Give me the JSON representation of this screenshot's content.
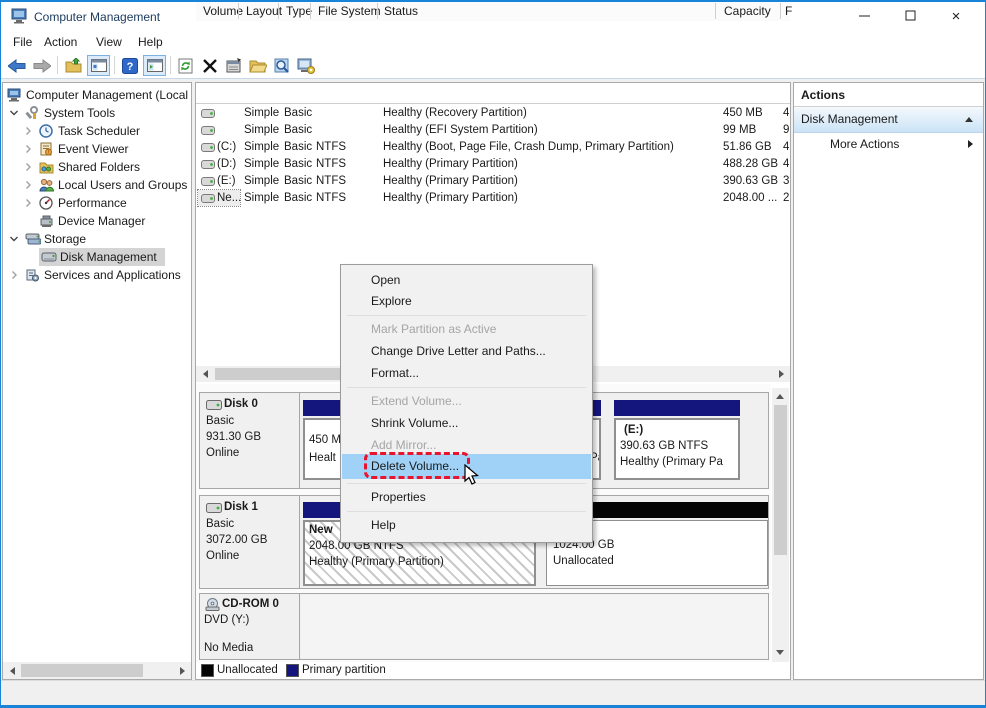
{
  "window": {
    "title": "Computer Management"
  },
  "menu_bar": {
    "items": [
      "File",
      "Action",
      "View",
      "Help"
    ]
  },
  "tree": {
    "items": [
      {
        "label": "Computer Management (Local"
      },
      {
        "label": "System Tools"
      },
      {
        "label": "Task Scheduler"
      },
      {
        "label": "Event Viewer"
      },
      {
        "label": "Shared Folders"
      },
      {
        "label": "Local Users and Groups"
      },
      {
        "label": "Performance"
      },
      {
        "label": "Device Manager"
      },
      {
        "label": "Storage"
      },
      {
        "label": "Disk Management"
      },
      {
        "label": "Services and Applications"
      }
    ]
  },
  "volume_table": {
    "headers": [
      "Volume",
      "Layout",
      "Type",
      "File System",
      "Status",
      "Capacity",
      "F"
    ],
    "rows": [
      {
        "volume": "",
        "layout": "Simple",
        "type": "Basic",
        "fs": "",
        "status": "Healthy (Recovery Partition)",
        "capacity": "450 MB",
        "free": "4"
      },
      {
        "volume": "",
        "layout": "Simple",
        "type": "Basic",
        "fs": "",
        "status": "Healthy (EFI System Partition)",
        "capacity": "99 MB",
        "free": "9"
      },
      {
        "volume": "(C:)",
        "layout": "Simple",
        "type": "Basic",
        "fs": "NTFS",
        "status": "Healthy (Boot, Page File, Crash Dump, Primary Partition)",
        "capacity": "51.86 GB",
        "free": "4"
      },
      {
        "volume": "(D:)",
        "layout": "Simple",
        "type": "Basic",
        "fs": "NTFS",
        "status": "Healthy (Primary Partition)",
        "capacity": "488.28 GB",
        "free": "4"
      },
      {
        "volume": "(E:)",
        "layout": "Simple",
        "type": "Basic",
        "fs": "NTFS",
        "status": "Healthy (Primary Partition)",
        "capacity": "390.63 GB",
        "free": "3"
      },
      {
        "volume": "Ne...",
        "layout": "Simple",
        "type": "Basic",
        "fs": "NTFS",
        "status": "Healthy (Primary Partition)",
        "capacity": "2048.00 ...",
        "free": "2"
      }
    ]
  },
  "context_menu": {
    "items": [
      {
        "label": "Open",
        "state": "enabled"
      },
      {
        "label": "Explore",
        "state": "enabled"
      },
      {
        "label": "Mark Partition as Active",
        "state": "disabled"
      },
      {
        "label": "Change Drive Letter and Paths...",
        "state": "enabled"
      },
      {
        "label": "Format...",
        "state": "enabled"
      },
      {
        "label": "Extend Volume...",
        "state": "disabled"
      },
      {
        "label": "Shrink Volume...",
        "state": "enabled"
      },
      {
        "label": "Add Mirror...",
        "state": "disabled"
      },
      {
        "label": "Delete Volume...",
        "state": "highlighted"
      },
      {
        "label": "Properties",
        "state": "enabled"
      },
      {
        "label": "Help",
        "state": "enabled"
      }
    ]
  },
  "disk_view": {
    "disk0": {
      "name": "Disk 0",
      "type": "Basic",
      "size": "931.30 GB",
      "status": "Online",
      "p1_line1": "450 M",
      "p1_line2": "Healt",
      "p2_tail": "Pa",
      "e_name": "(E:)",
      "e_size": "390.63 GB NTFS",
      "e_status": "Healthy (Primary Pa"
    },
    "disk1": {
      "name": "Disk 1",
      "type": "Basic",
      "size": "3072.00 GB",
      "status": "Online",
      "nv_name": "New",
      "nv_size": "2048.00 GB NTFS",
      "nv_status": "Healthy (Primary Partition)",
      "ua_size": "1024.00 GB",
      "ua_label": "Unallocated"
    },
    "cdrom": {
      "name": "CD-ROM 0",
      "drive": "DVD (Y:)",
      "media": "No Media"
    }
  },
  "legend": {
    "unallocated": "Unallocated",
    "primary": "Primary partition"
  },
  "actions_panel": {
    "title": "Actions",
    "group": "Disk Management",
    "more": "More Actions"
  },
  "colors": {
    "accent_border": "#1883d7",
    "primary_partition": "#15157e",
    "unallocated": "#040404",
    "menu_highlight": "#9fd2f6",
    "annotation_red": "#e8132d"
  }
}
